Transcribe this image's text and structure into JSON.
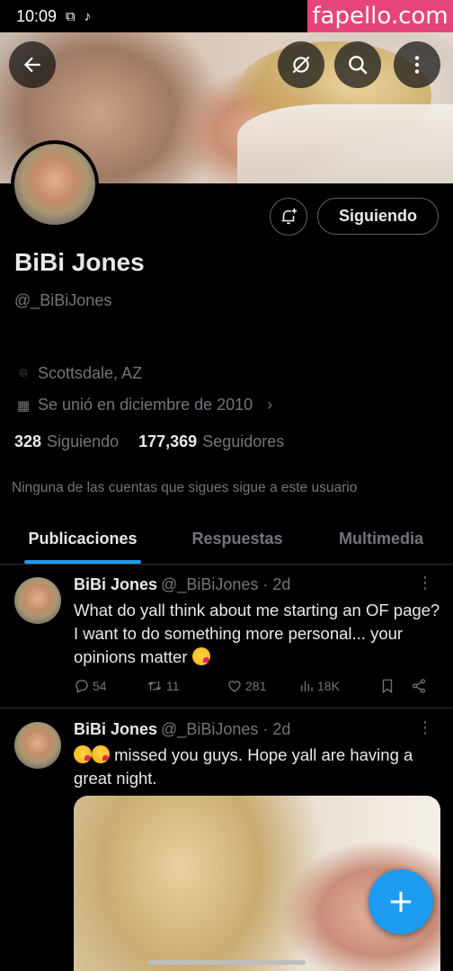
{
  "status_bar": {
    "time": "10:09"
  },
  "watermark": "fapello.com",
  "header": {
    "back_icon": "arrow-left-icon",
    "sync_icon": "sync-off-icon",
    "search_icon": "search-icon",
    "more_icon": "more-vertical-icon"
  },
  "profile": {
    "display_name": "BiBi Jones",
    "handle": "@_BiBiJones",
    "follow_button": "Siguiendo",
    "location": "Scottsdale, AZ",
    "joined": "Se unió en diciembre de 2010",
    "following_count": "328",
    "following_label": "Siguiendo",
    "followers_count": "177,369",
    "followers_label": "Seguidores",
    "followers_note": "Ninguna de las cuentas que sigues sigue a este usuario"
  },
  "tabs": [
    {
      "label": "Publicaciones",
      "active": true
    },
    {
      "label": "Respuestas",
      "active": false
    },
    {
      "label": "Multimedia",
      "active": false
    }
  ],
  "posts": [
    {
      "name": "BiBi Jones",
      "meta": "@_BiBiJones · 2d",
      "text": "What do yall think about me starting an OF page? I want to do something more personal... your opinions matter",
      "replies": "54",
      "reposts": "11",
      "likes": "281",
      "views": "18K"
    },
    {
      "name": "BiBi Jones",
      "meta": "@_BiBiJones · 2d",
      "text": "missed you guys. Hope yall are having a great night."
    }
  ],
  "colors": {
    "accent": "#1d9bf0",
    "background": "#000000",
    "muted": "#71767b",
    "text": "#e7e9ea",
    "watermark": "#e6457a"
  }
}
